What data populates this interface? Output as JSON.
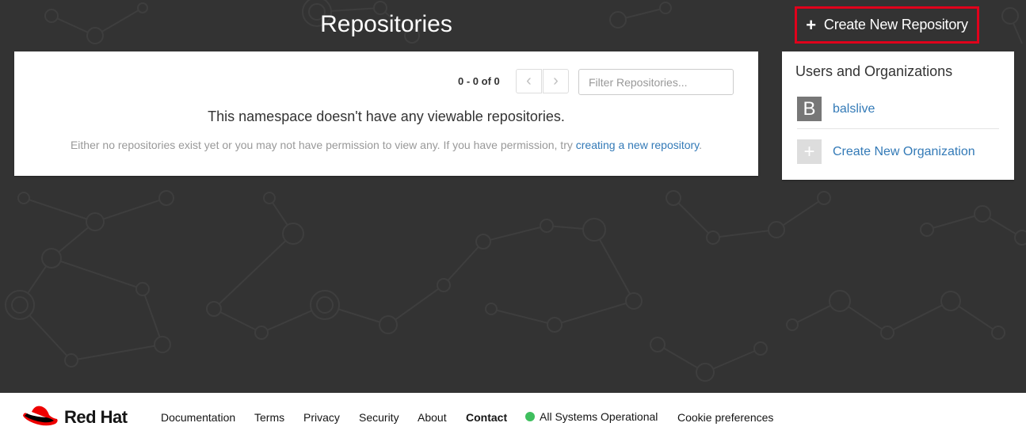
{
  "page": {
    "title": "Repositories"
  },
  "toolbar": {
    "create_repo_label": "Create New Repository",
    "create_repo_icon": "plus-icon"
  },
  "repo_list": {
    "pager_count": "0 - 0 of 0",
    "prev_icon": "chevron-left-icon",
    "next_icon": "chevron-right-icon",
    "filter_placeholder": "Filter Repositories...",
    "filter_value": "",
    "empty_title": "This namespace doesn't have any viewable repositories.",
    "empty_text": "Either no repositories exist yet or you may not have permission to view any. If you have permission, try ",
    "empty_link": "creating a new repository",
    "empty_suffix": "."
  },
  "orgs": {
    "heading": "Users and Organizations",
    "user": {
      "avatar_letter": "B",
      "name": "balslive"
    },
    "create": {
      "avatar_symbol": "+",
      "label": "Create New Organization"
    }
  },
  "footer": {
    "logo_text": "Red Hat",
    "logo_icon": "red-hat-logo-icon",
    "links": {
      "documentation": "Documentation",
      "terms": "Terms",
      "privacy": "Privacy",
      "security": "Security",
      "about": "About",
      "contact": "Contact",
      "status": "All Systems Operational",
      "cookies": "Cookie preferences"
    },
    "status_color": "#3fbf5e"
  },
  "colors": {
    "background": "#333333",
    "link": "#337ab7",
    "highlight_border": "#e0001b",
    "brand_red": "#ee0000"
  }
}
